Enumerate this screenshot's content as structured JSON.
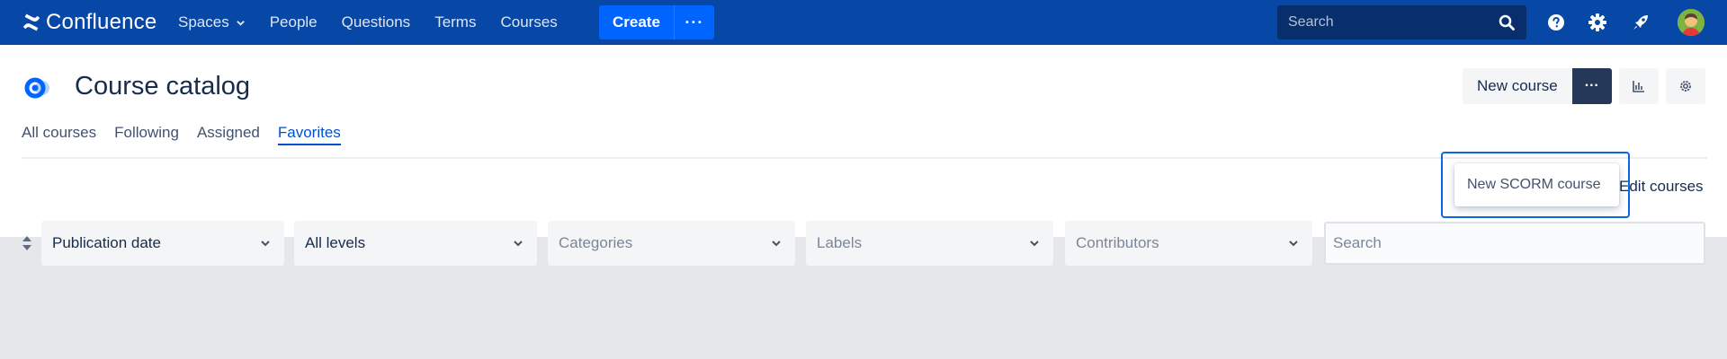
{
  "topnav": {
    "brand": "Confluence",
    "items": [
      {
        "label": "Spaces",
        "has_dropdown": true
      },
      {
        "label": "People"
      },
      {
        "label": "Questions"
      },
      {
        "label": "Terms"
      },
      {
        "label": "Courses"
      }
    ],
    "create_label": "Create",
    "more_label": "···",
    "search_placeholder": "Search",
    "icons": [
      "search-icon",
      "help-icon",
      "settings-icon",
      "notifications-rocket-icon",
      "avatar"
    ]
  },
  "header": {
    "title": "Course catalog",
    "new_course_label": "New course",
    "more_label": "···"
  },
  "tabs": [
    {
      "label": "All courses",
      "active": false
    },
    {
      "label": "Following",
      "active": false
    },
    {
      "label": "Assigned",
      "active": false
    },
    {
      "label": "Favorites",
      "active": true
    }
  ],
  "edit_courses_label": "Edit courses",
  "dropdown": {
    "items": [
      {
        "label": "New SCORM course"
      }
    ]
  },
  "filters": {
    "sort": {
      "value": "Publication date"
    },
    "level": {
      "value": "All levels"
    },
    "categories": {
      "placeholder": "Categories"
    },
    "labels": {
      "placeholder": "Labels"
    },
    "contributors": {
      "placeholder": "Contributors"
    },
    "search_placeholder": "Search"
  },
  "colors": {
    "nav_bg": "#0747a6",
    "create_bg": "#0065ff",
    "active_tab": "#0052cc",
    "highlight_border": "#0b66e4",
    "more_btn_bg": "#253858",
    "page_bg": "#e6e7ea"
  }
}
